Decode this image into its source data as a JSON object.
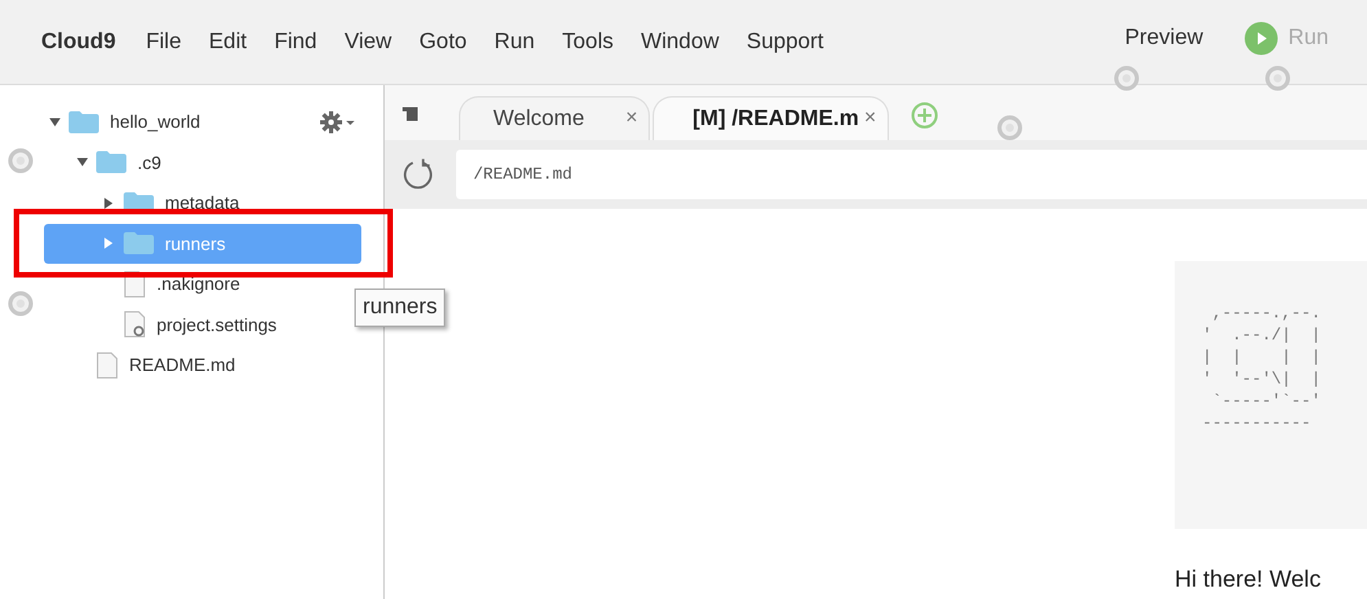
{
  "menu_bar": {
    "brand": "Cloud9",
    "items": [
      "File",
      "Edit",
      "Find",
      "View",
      "Goto",
      "Run",
      "Tools",
      "Window",
      "Support"
    ],
    "preview": "Preview",
    "run": {
      "label": "Run",
      "disabled": true
    }
  },
  "sidebar": {
    "tree": [
      {
        "name": "hello_world",
        "kind": "folder",
        "expanded": true,
        "selected": false,
        "children": [
          {
            "name": ".c9",
            "kind": "folder",
            "expanded": true,
            "selected": false,
            "children": [
              {
                "name": "metadata",
                "kind": "folder",
                "expanded": false,
                "selected": false
              },
              {
                "name": "runners",
                "kind": "folder",
                "expanded": false,
                "selected": true
              },
              {
                "name": ".nakignore",
                "kind": "file",
                "selected": false
              },
              {
                "name": "project.settings",
                "kind": "settings",
                "selected": false
              }
            ]
          },
          {
            "name": "README.md",
            "kind": "file",
            "selected": false
          }
        ]
      }
    ]
  },
  "tooltip": "runners",
  "tabs": [
    {
      "label": "Welcome",
      "close": "×",
      "selected": false
    },
    {
      "label": "[M] /README.m",
      "close": "×",
      "selected": true
    }
  ],
  "address": {
    "value": "/README.md"
  },
  "preview": {
    "ascii_art": [
      " ,-----.,--.",
      "'  .--./|  |",
      "|  |    |  |",
      "'  '--'\\|  |",
      " `-----'`--'",
      "-----------"
    ],
    "greeting": "Hi there! Welc"
  }
}
